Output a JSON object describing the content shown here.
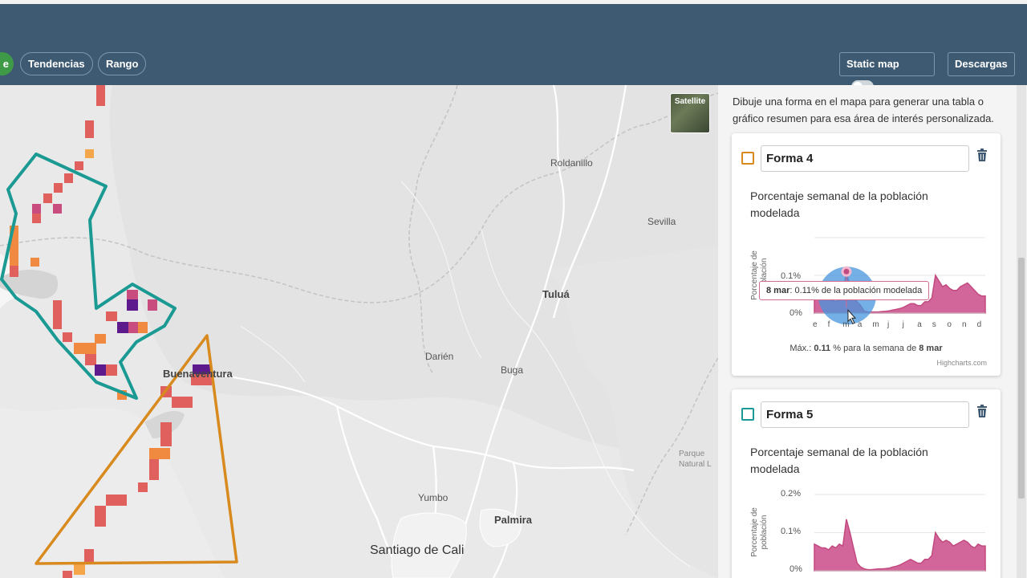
{
  "header": {
    "partial_tab_label": "e",
    "tabs": [
      {
        "label": "Tendencias"
      },
      {
        "label": "Rango"
      }
    ],
    "static_map_label": "Static map",
    "static_map_on": false,
    "download_label": "Descargas"
  },
  "map": {
    "satellite_label": "Satellite",
    "places": [
      {
        "name": "Roldanillo"
      },
      {
        "name": "Sevilla"
      },
      {
        "name": "Tuluá"
      },
      {
        "name": "Buenaventura"
      },
      {
        "name": "Darién"
      },
      {
        "name": "Buga"
      },
      {
        "name": "Parque Natural L"
      },
      {
        "name": "Yumbo"
      },
      {
        "name": "Palmira"
      },
      {
        "name": "Santiago de Cali"
      }
    ],
    "colors": {
      "teal": "#1b9a94",
      "orange": "#d88a1f",
      "cell_red": "#e0605e",
      "cell_orange": "#f08a40",
      "cell_purple": "#5c1a8c"
    }
  },
  "panel": {
    "intro": "Dibuje una forma en el mapa para generar una tabla o gráfico resumen para esa área de interés personalizada.",
    "shapes": [
      {
        "name": "Forma 4",
        "color": "#d88a1f",
        "chart_title": "Porcentaje semanal de la población modelada",
        "y_axis_label": "Porcentaje de población",
        "y_ticks": [
          "0.1%",
          "0%"
        ],
        "x_ticks": [
          "e",
          "f",
          "m",
          "a",
          "m",
          "j",
          "j",
          "a",
          "s",
          "o",
          "n",
          "d"
        ],
        "tooltip_date": "8 mar",
        "tooltip_text": ": 0.11% de la población modelada",
        "max_prefix": "Máx.:",
        "max_value": "0.11",
        "max_middle": "% para la semana de",
        "max_week": "8 mar",
        "credits": "Highcharts.com"
      },
      {
        "name": "Forma 5",
        "color": "#1b9a94",
        "chart_title": "Porcentaje semanal de la población modelada",
        "y_axis_label": "Porcentaje de población",
        "y_ticks": [
          "0.2%",
          "0.1%",
          "0%"
        ]
      }
    ]
  },
  "chart_data": [
    {
      "type": "area",
      "title": "Porcentaje semanal de la población modelada",
      "ylabel": "Porcentaje de población",
      "x": [
        "e",
        "",
        "",
        "",
        "f",
        "",
        "",
        "",
        "m",
        "",
        "",
        "",
        "a",
        "",
        "",
        "",
        "m",
        "",
        "",
        "",
        "j",
        "",
        "",
        "",
        "j",
        "",
        "",
        "",
        "a",
        "",
        "",
        "",
        "s",
        "",
        "",
        "",
        "o",
        "",
        "",
        "",
        "n",
        "",
        "",
        "",
        "d",
        "",
        ""
      ],
      "series": [
        {
          "values": [
            0.06,
            0.055,
            0.05,
            0.045,
            0.04,
            0.035,
            0.03,
            0.035,
            0.05,
            0.11,
            0.07,
            0.04,
            0.03,
            0.02,
            0.005,
            0.003,
            0.003,
            0.003,
            0.003,
            0.004,
            0.005,
            0.006,
            0.008,
            0.01,
            0.012,
            0.015,
            0.02,
            0.025,
            0.025,
            0.02,
            0.02,
            0.03,
            0.03,
            0.04,
            0.1,
            0.085,
            0.07,
            0.075,
            0.065,
            0.06,
            0.06,
            0.07,
            0.075,
            0.08,
            0.07,
            0.06,
            0.05,
            0.045,
            0.045
          ]
        }
      ],
      "ylim": [
        0,
        0.2
      ],
      "highlight": {
        "x": "8 mar",
        "y": 0.11
      }
    },
    {
      "type": "area",
      "title": "Porcentaje semanal de la población modelada",
      "ylabel": "Porcentaje de población",
      "series": [
        {
          "values": [
            0.07,
            0.065,
            0.06,
            0.06,
            0.055,
            0.065,
            0.06,
            0.07,
            0.065,
            0.135,
            0.1,
            0.06,
            0.02,
            0.01,
            0.005,
            0.003,
            0.003,
            0.004,
            0.005,
            0.005,
            0.006,
            0.007,
            0.01,
            0.012,
            0.015,
            0.02,
            0.025,
            0.03,
            0.025,
            0.02,
            0.02,
            0.03,
            0.03,
            0.04,
            0.1,
            0.085,
            0.075,
            0.08,
            0.075,
            0.065,
            0.07,
            0.075,
            0.08,
            0.075,
            0.065,
            0.06,
            0.07,
            0.065,
            0.065
          ]
        }
      ],
      "ylim": [
        0,
        0.2
      ]
    }
  ]
}
